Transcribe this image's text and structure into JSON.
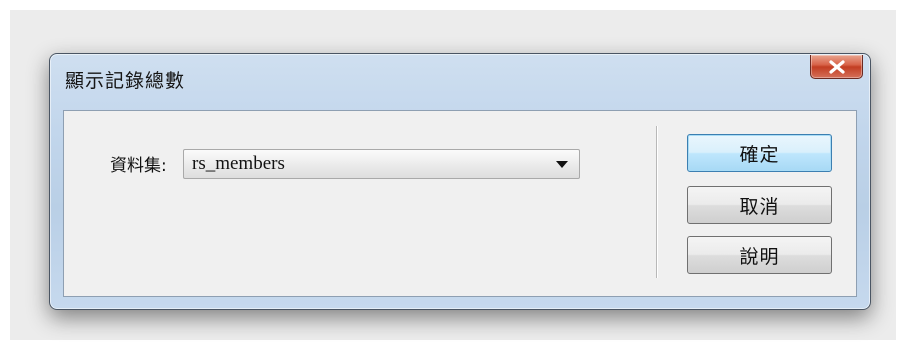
{
  "window": {
    "title": "顯示記錄總數"
  },
  "form": {
    "dataset_label": "資料集:",
    "dataset_value": "rs_members"
  },
  "buttons": {
    "ok": "確定",
    "cancel": "取消",
    "help": "說明"
  },
  "icons": {
    "close": "close-icon",
    "dropdown": "chevron-down-icon"
  },
  "colors": {
    "close_button": "#c8452b",
    "default_button_border": "#3c7fb1",
    "title_bar": "#c2d6ec"
  }
}
